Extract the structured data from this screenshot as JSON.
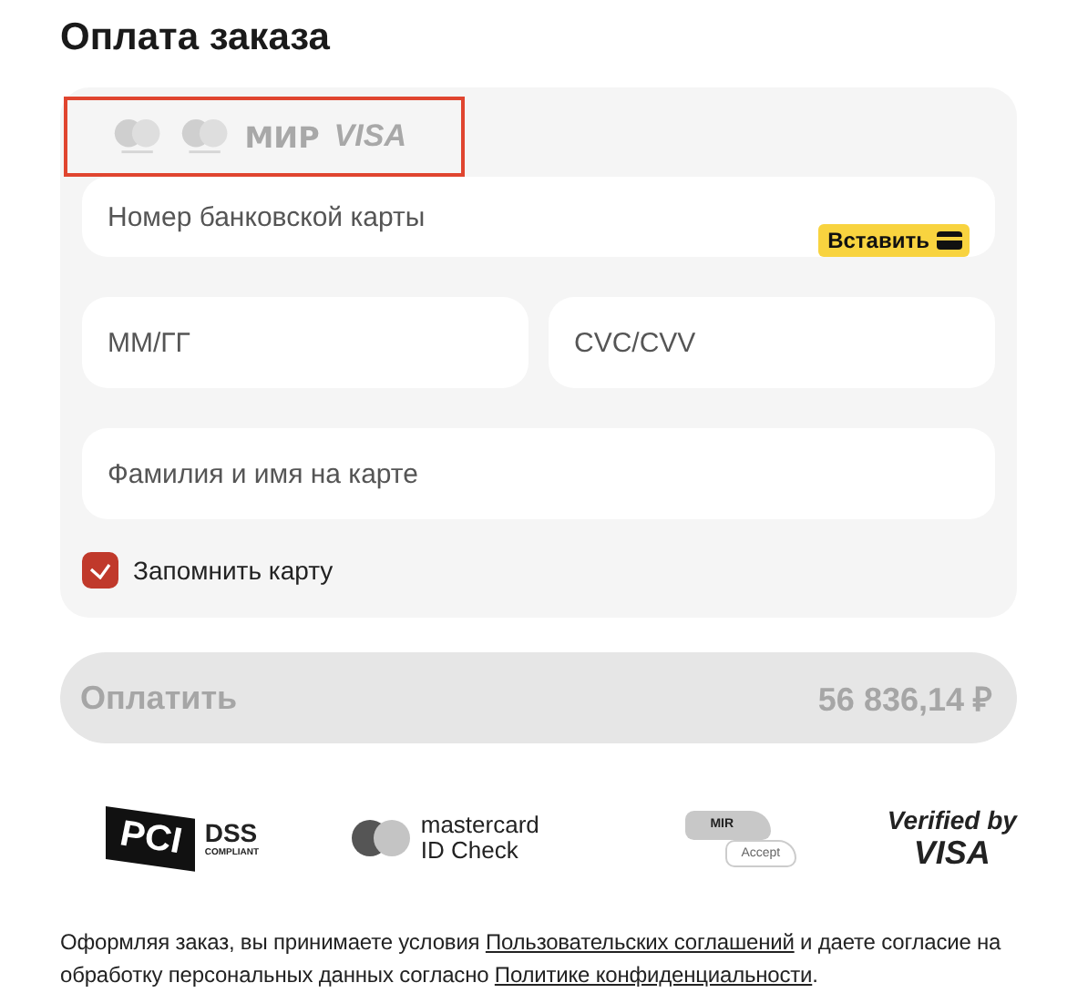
{
  "title": "Оплата заказа",
  "card_logos": {
    "highlighted": true,
    "items": [
      {
        "kind": "mastercard"
      },
      {
        "kind": "maestro"
      },
      {
        "kind": "mir",
        "text": "МИР"
      },
      {
        "kind": "visa",
        "text": "VISA"
      }
    ]
  },
  "fields": [
    {
      "placeholder": "Номер банковской карты",
      "paste_button": "Вставить"
    },
    {
      "placeholder": "ММ/ГГ"
    },
    {
      "placeholder": "CVC/CVV"
    },
    {
      "placeholder": "Фамилия и имя на карте"
    }
  ],
  "remember_card": {
    "label": "Запомнить карту",
    "checked": true
  },
  "pay_button": {
    "label": "Оплатить",
    "amount": "56 836,14 ₽",
    "disabled": true
  },
  "badges": [
    {
      "kind": "pci",
      "text": "PCI",
      "title": "DSS",
      "note": "COMPLIANT"
    },
    {
      "kind": "mastercard",
      "title": "mastercard",
      "note": "ID Check"
    },
    {
      "kind": "mir",
      "text": "MIR",
      "note": "Accept"
    },
    {
      "kind": "visa",
      "title": "Verified by",
      "text": "VISA"
    }
  ],
  "consent": [
    {
      "text": "Оформляя заказ, вы принимаете условия "
    },
    {
      "text": "Пользовательских соглашений",
      "link": true
    },
    {
      "text": " и даете согласие на обработку персональных данных согласно "
    },
    {
      "text": "Политике конфиденциальности",
      "link": true
    },
    {
      "text": "."
    }
  ]
}
